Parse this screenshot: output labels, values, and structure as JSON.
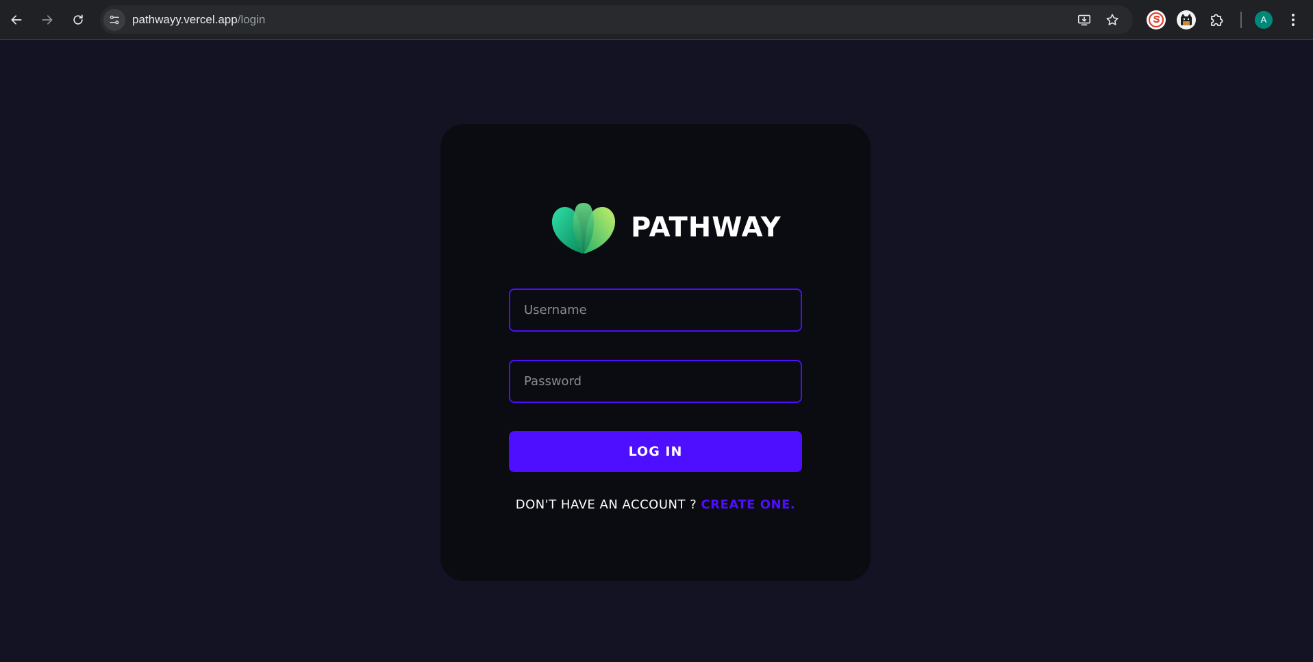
{
  "browser": {
    "url_host": "pathwayy.vercel.app",
    "url_path": "/login",
    "profile_initial": "A",
    "icons": {
      "back": "arrow-left-icon",
      "forward": "arrow-right-icon",
      "reload": "reload-icon",
      "site_info": "tune-icon",
      "install": "install-app-icon",
      "bookmark": "star-icon",
      "extensions": "puzzle-icon",
      "menu": "kebab-menu-icon"
    },
    "colors": {
      "chrome_bg": "#202124",
      "omnibox_bg": "#282a2d",
      "avatar_bg": "#00897b"
    }
  },
  "login": {
    "brand_name": "PATHWAY",
    "username_placeholder": "Username",
    "password_placeholder": "Password",
    "submit_label": "LOG IN",
    "signup_prompt": "DON'T HAVE AN ACCOUNT ? ",
    "signup_link": "CREATE ONE."
  },
  "theme": {
    "page_bg": "#131324",
    "card_bg": "#0b0b12",
    "accent": "#4e0eff",
    "text": "#ffffff"
  }
}
